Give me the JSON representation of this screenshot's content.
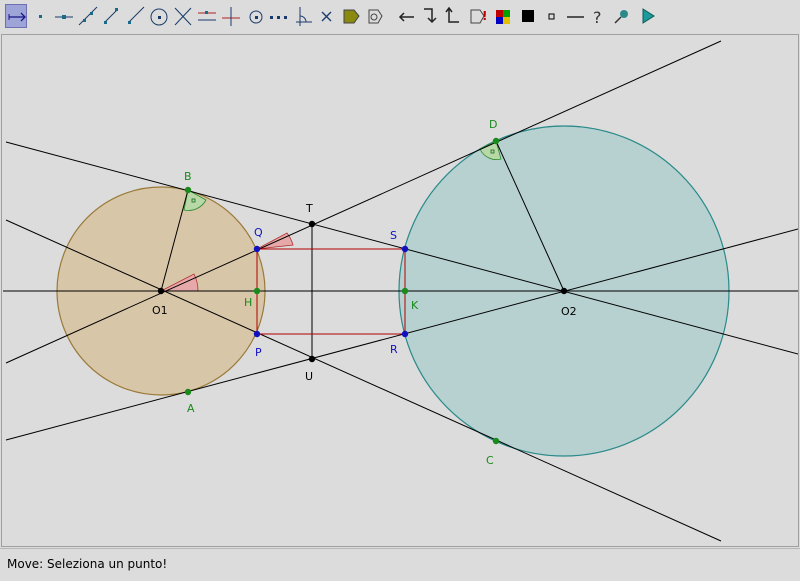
{
  "toolbar": {
    "tools": [
      {
        "name": "move-tool-icon",
        "active": true
      },
      {
        "name": "point-tool-icon"
      },
      {
        "name": "point-on-object-tool-icon"
      },
      {
        "name": "line-tool-icon"
      },
      {
        "name": "segment-tool-icon"
      },
      {
        "name": "ray-tool-icon"
      },
      {
        "name": "circle-tool-icon"
      },
      {
        "name": "intersection-tool-icon"
      },
      {
        "name": "parallel-line-tool-icon"
      },
      {
        "name": "perpendicular-line-tool-icon"
      },
      {
        "name": "midpoint-tool-icon"
      },
      {
        "name": "compass-tool-icon"
      },
      {
        "name": "angle-tool-icon"
      },
      {
        "name": "delete-tool-icon"
      },
      {
        "name": "color-fill-tool-icon"
      },
      {
        "name": "macro-tool-icon"
      },
      {
        "name": "undo-tool-icon"
      },
      {
        "name": "redo-tool-icon"
      },
      {
        "name": "step-back-tool-icon"
      },
      {
        "name": "hide-show-tool-icon"
      },
      {
        "name": "color-palette-tool-icon"
      },
      {
        "name": "black-square-tool-icon"
      },
      {
        "name": "small-square-tool-icon"
      },
      {
        "name": "line-style-tool-icon"
      },
      {
        "name": "help-tool-icon"
      },
      {
        "name": "pin-tool-icon"
      },
      {
        "name": "play-tool-icon"
      }
    ]
  },
  "canvas": {
    "points": [
      {
        "id": "O1",
        "label": "O1",
        "color": "#000000"
      },
      {
        "id": "O2",
        "label": "O2",
        "color": "#000000"
      },
      {
        "id": "B",
        "label": "B",
        "color": "#1a8a1a"
      },
      {
        "id": "A",
        "label": "A",
        "color": "#1a8a1a"
      },
      {
        "id": "D",
        "label": "D",
        "color": "#1a8a1a"
      },
      {
        "id": "C",
        "label": "C",
        "color": "#1a8a1a"
      },
      {
        "id": "T",
        "label": "T",
        "color": "#000000"
      },
      {
        "id": "U",
        "label": "U",
        "color": "#000000"
      },
      {
        "id": "Q",
        "label": "Q",
        "color": "#1010c0"
      },
      {
        "id": "P",
        "label": "P",
        "color": "#1010c0"
      },
      {
        "id": "S",
        "label": "S",
        "color": "#1010c0"
      },
      {
        "id": "R",
        "label": "R",
        "color": "#1010c0"
      },
      {
        "id": "H",
        "label": "H",
        "color": "#1a8a1a"
      },
      {
        "id": "K",
        "label": "K",
        "color": "#1a8a1a"
      }
    ],
    "colors": {
      "circle1_fill": "#d8c6a8",
      "circle1_stroke": "#9a7a3a",
      "circle2_fill": "#b7d0d0",
      "circle2_stroke": "#2a8a8a",
      "rect_stroke": "#b00000",
      "angle_fill": "#e6a8a8",
      "right_angle_fill": "#b8d8a8"
    }
  },
  "status": {
    "text": "Move: Seleziona un punto!"
  }
}
